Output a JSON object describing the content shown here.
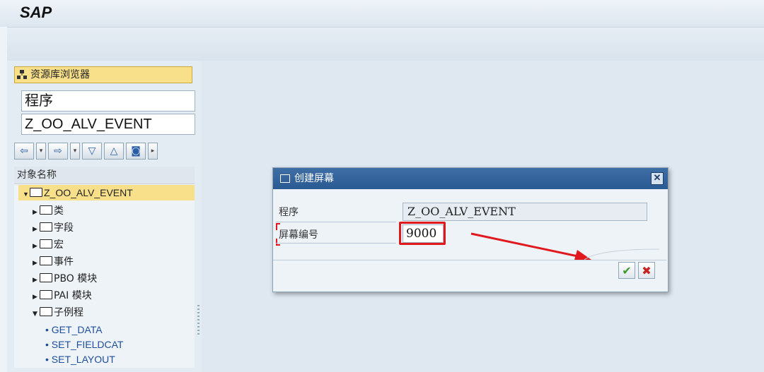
{
  "app": {
    "logo": "SAP"
  },
  "left_panel": {
    "repository_button": "资源库浏览器",
    "object_type_field": "程序",
    "object_name_field": "Z_OO_ALV_EVENT",
    "tree_header": "对象名称",
    "tree": {
      "root": "Z_OO_ALV_EVENT",
      "nodes": [
        "类",
        "字段",
        "宏",
        "事件",
        "PBO 模块",
        "PAI 模块",
        "子例程"
      ],
      "leaves": [
        "GET_DATA",
        "SET_FIELDCAT",
        "SET_LAYOUT"
      ]
    }
  },
  "dialog": {
    "title": "创建屏幕",
    "program_label": "程序",
    "program_value": "Z_OO_ALV_EVENT",
    "screen_label": "屏幕编号",
    "screen_value": "9000",
    "confirm_icon": "check-icon",
    "cancel_icon": "cancel-x-icon"
  },
  "colors": {
    "highlight": "#e0191f",
    "selection": "#f8e08a",
    "dialog_title": "#2f6099"
  }
}
